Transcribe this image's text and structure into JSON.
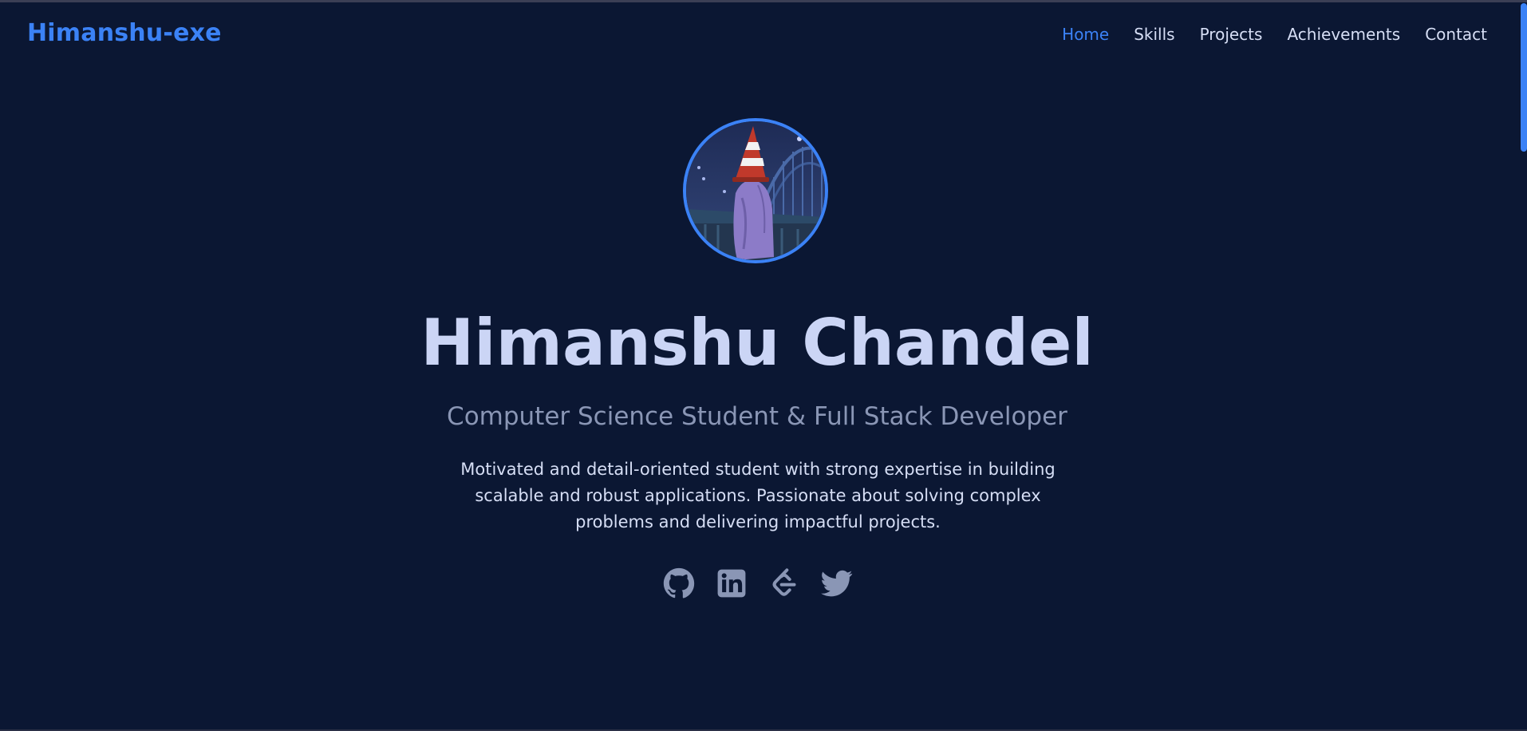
{
  "brand": {
    "name": "Himanshu-exe",
    "accent_color": "#3b82f6"
  },
  "nav": {
    "items": [
      {
        "label": "Home",
        "active": true
      },
      {
        "label": "Skills",
        "active": false
      },
      {
        "label": "Projects",
        "active": false
      },
      {
        "label": "Achievements",
        "active": false
      },
      {
        "label": "Contact",
        "active": false
      }
    ]
  },
  "hero": {
    "avatar_icon": "profile-avatar-illustration",
    "name": "Himanshu Chandel",
    "subtitle": "Computer Science Student & Full Stack Developer",
    "bio": "Motivated and detail-oriented student with strong expertise in building scalable and robust applications. Passionate about solving complex problems and delivering impactful projects."
  },
  "socials": [
    {
      "icon": "github-icon"
    },
    {
      "icon": "linkedin-icon"
    },
    {
      "icon": "leetcode-icon"
    },
    {
      "icon": "twitter-icon"
    }
  ],
  "colors": {
    "background": "#0b1733",
    "heading": "#cbd5f5",
    "subtitle": "#8a96b5",
    "icon": "#8a96b5"
  }
}
